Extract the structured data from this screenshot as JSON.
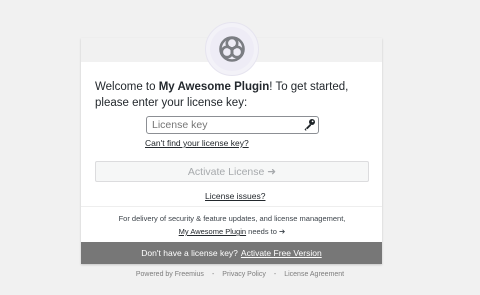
{
  "intro": {
    "prefix": "Welcome to ",
    "plugin_name": "My Awesome Plugin",
    "suffix": "! To get started, please enter your license key:"
  },
  "license_field": {
    "placeholder": "License key",
    "icon": "key-icon"
  },
  "links": {
    "cant_find": "Can't find your license key?",
    "license_issues": "License issues?"
  },
  "activate_button": {
    "label": "Activate License ➜"
  },
  "delivery": {
    "line1": "For delivery of security & feature updates, and license management,",
    "plugin_link": "My Awesome Plugin",
    "line2_suffix": " needs to ➔"
  },
  "bottom_bar": {
    "text": "Don't have a license key?",
    "link": "Activate Free Version"
  },
  "footer": {
    "powered": "Powered by Freemius",
    "sep": "-",
    "privacy": "Privacy Policy",
    "agreement": "License Agreement"
  }
}
